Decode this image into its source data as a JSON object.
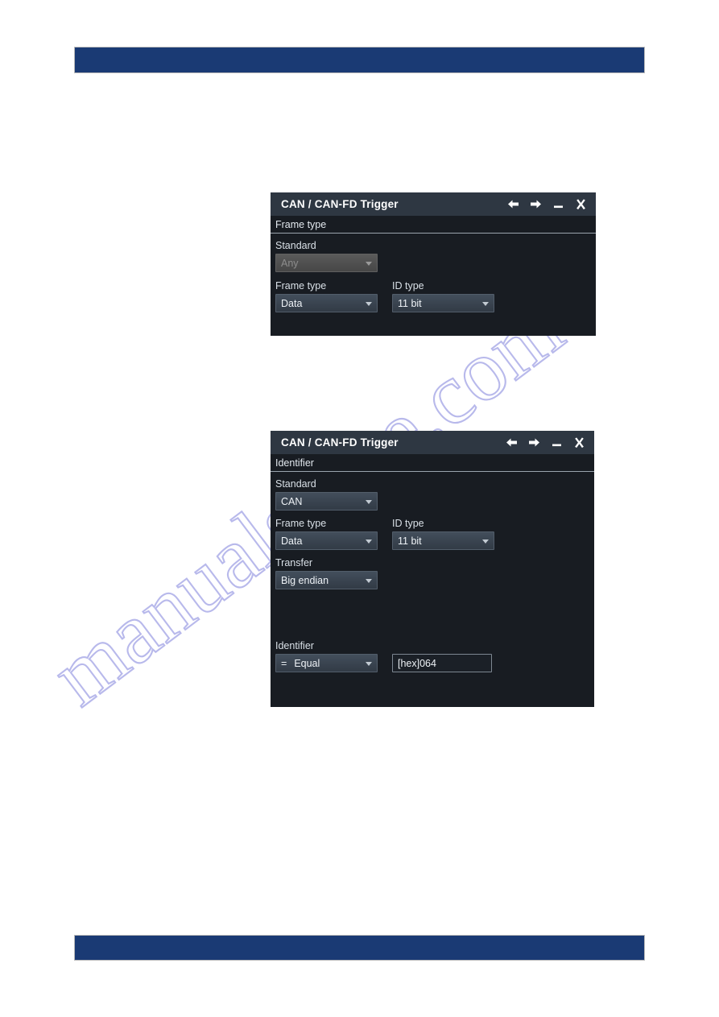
{
  "page": {
    "banner_color": "#1a3a74",
    "watermark_text": "manualshive.com"
  },
  "dialogs": [
    {
      "title": "CAN / CAN-FD Trigger",
      "section": "Frame type",
      "window_buttons": [
        "back-arrow",
        "forward-arrow",
        "minimize",
        "close"
      ],
      "fields": [
        {
          "label": "Standard",
          "type": "combo",
          "value": "Any",
          "disabled": true
        },
        {
          "label": "Frame type",
          "type": "combo",
          "value": "Data",
          "disabled": false
        },
        {
          "label": "ID type",
          "type": "combo",
          "value": "11 bit",
          "disabled": false
        }
      ]
    },
    {
      "title": "CAN / CAN-FD Trigger",
      "section": "Identifier",
      "window_buttons": [
        "back-arrow",
        "forward-arrow",
        "minimize",
        "close"
      ],
      "fields": [
        {
          "label": "Standard",
          "type": "combo",
          "value": "CAN",
          "disabled": false
        },
        {
          "label": "Frame type",
          "type": "combo",
          "value": "Data",
          "disabled": false
        },
        {
          "label": "ID type",
          "type": "combo",
          "value": "11 bit",
          "disabled": false
        },
        {
          "label": "Transfer",
          "type": "combo",
          "value": "Big endian",
          "disabled": false
        },
        {
          "label": "Identifier",
          "type": "combo",
          "operator_symbol": "=",
          "value": "Equal",
          "disabled": false
        },
        {
          "label": "",
          "type": "textinput",
          "value": "[hex]064"
        }
      ]
    }
  ],
  "colors": {
    "dialog_body": "#181c22",
    "dialog_titlebar": "#2e3742",
    "combo_face": "#3a4551",
    "text_primary": "#e9eef4",
    "banner_blue": "#1a3a74",
    "watermark": "#8d8fe0"
  }
}
